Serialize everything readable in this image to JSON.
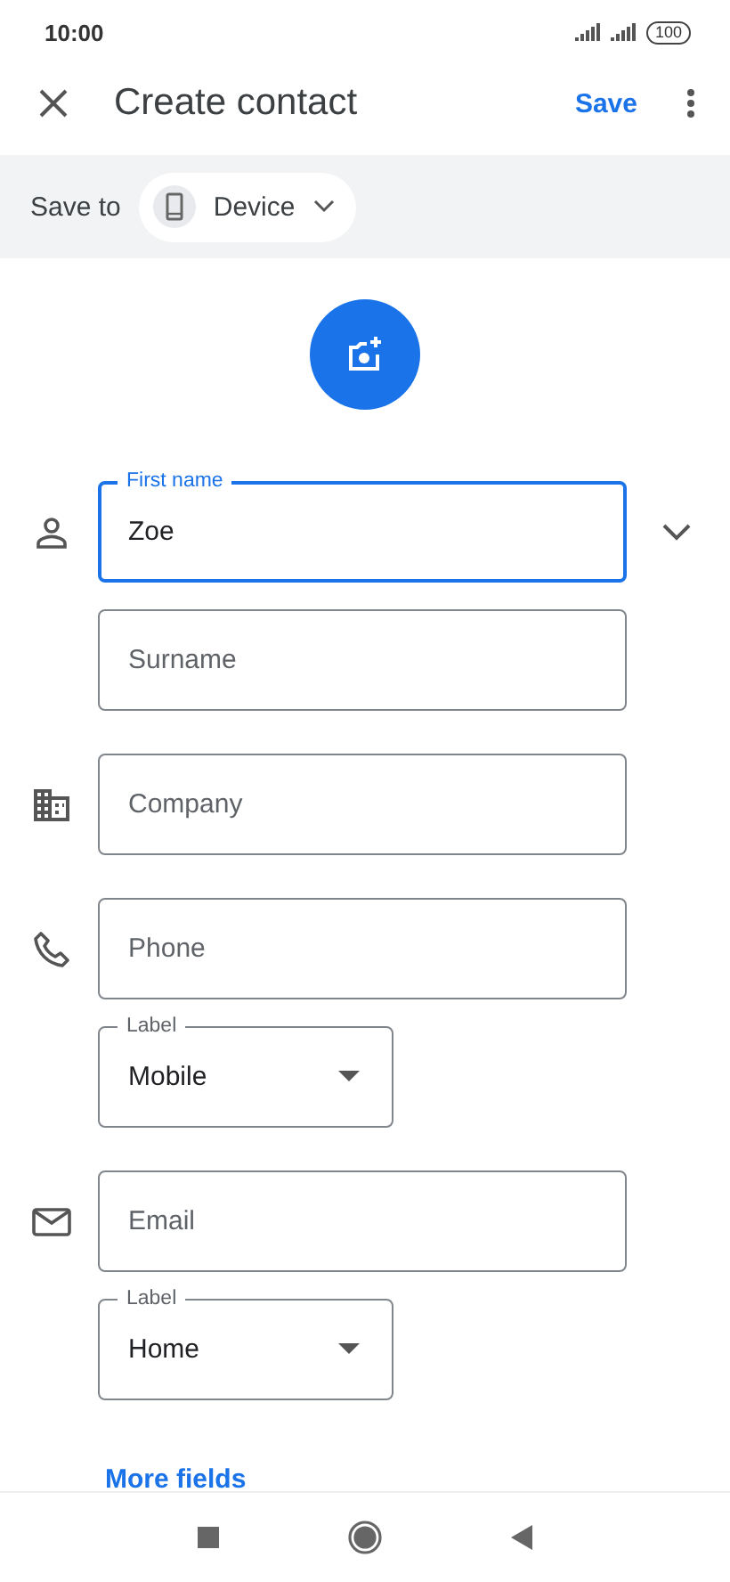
{
  "status_bar": {
    "time": "10:00",
    "battery": "100"
  },
  "app_bar": {
    "title": "Create contact",
    "save": "Save"
  },
  "save_to": {
    "label": "Save to",
    "account": "Device"
  },
  "name": {
    "expanded": false,
    "fields": [
      {
        "label": "First name",
        "value": "Zoe",
        "focused": true
      },
      {
        "placeholder": "Surname",
        "focused": false
      }
    ]
  },
  "company": {
    "placeholder": "Company",
    "focused": false
  },
  "phone": {
    "field": {
      "placeholder": "Phone",
      "focused": false
    },
    "type": {
      "label": "Label",
      "value": "Mobile"
    }
  },
  "email": {
    "field": {
      "placeholder": "Email",
      "focused": false
    },
    "type": {
      "label": "Label",
      "value": "Home"
    }
  },
  "more_fields": "More fields"
}
